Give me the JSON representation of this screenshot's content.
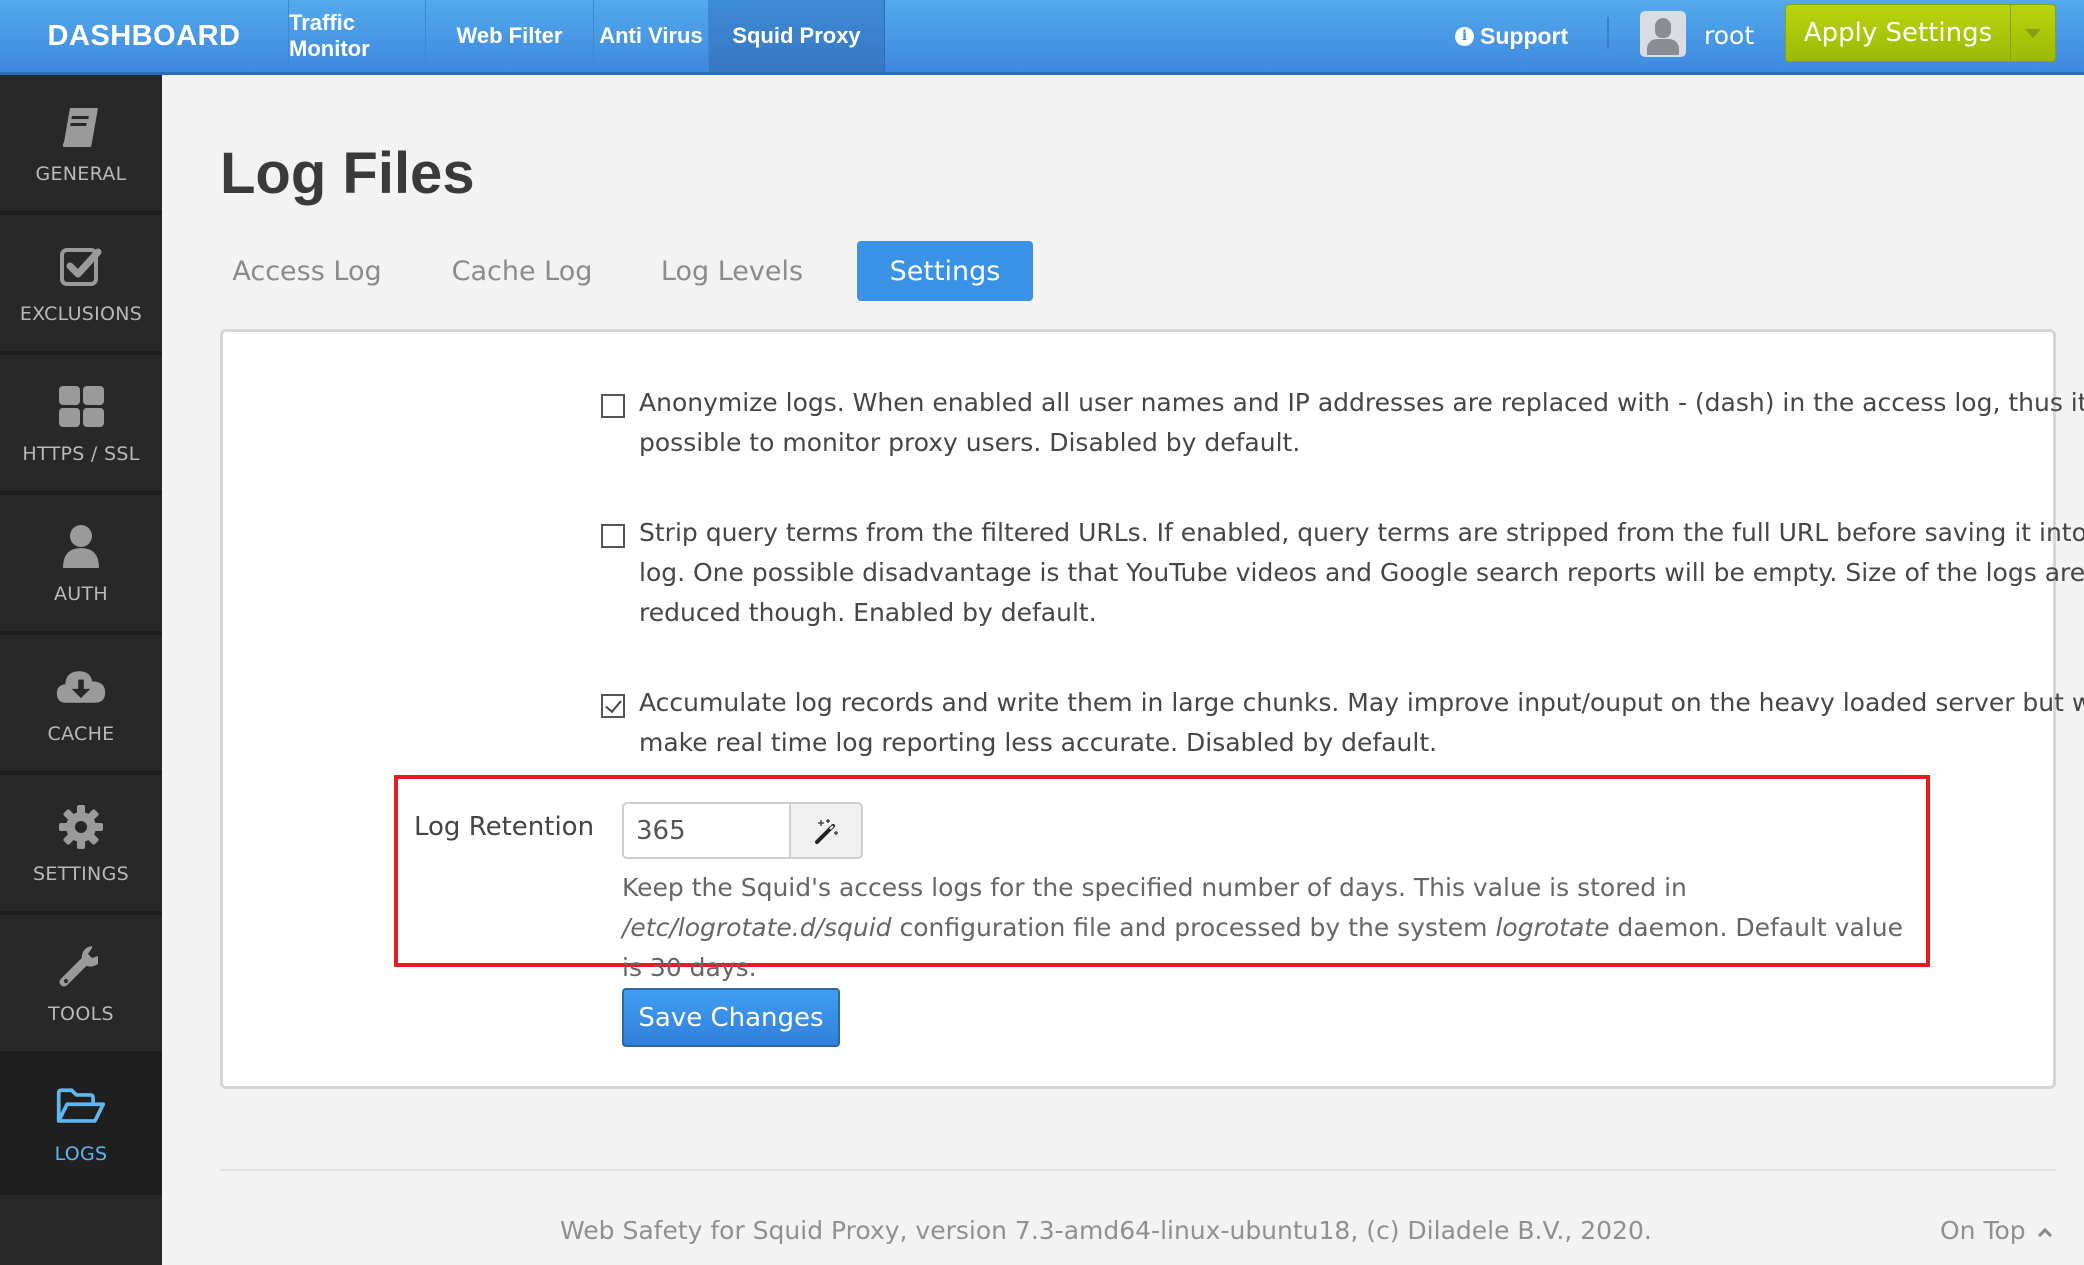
{
  "topnav": {
    "brand": "DASHBOARD",
    "items": [
      {
        "label": "Traffic Monitor",
        "active": false
      },
      {
        "label": "Web Filter",
        "active": false
      },
      {
        "label": "Anti Virus",
        "active": false
      },
      {
        "label": "Squid Proxy",
        "active": true
      }
    ],
    "support_label": "Support",
    "support_icon": "info-circle-icon",
    "user_icon": "user-avatar-icon",
    "username": "root",
    "apply_label": "Apply Settings",
    "apply_dropdown_icon": "caret-down-icon"
  },
  "sidebar": {
    "items": [
      {
        "label": "GENERAL",
        "icon": "book-icon",
        "active": false
      },
      {
        "label": "EXCLUSIONS",
        "icon": "check-square-icon",
        "active": false
      },
      {
        "label": "HTTPS / SSL",
        "icon": "grid-icon",
        "active": false
      },
      {
        "label": "AUTH",
        "icon": "user-icon",
        "active": false
      },
      {
        "label": "CACHE",
        "icon": "cloud-download-icon",
        "active": false
      },
      {
        "label": "SETTINGS",
        "icon": "gear-icon",
        "active": false
      },
      {
        "label": "TOOLS",
        "icon": "wrench-icon",
        "active": false
      },
      {
        "label": "LOGS",
        "icon": "folder-open-icon",
        "active": true
      }
    ]
  },
  "page": {
    "title": "Log Files",
    "tabs": [
      {
        "label": "Access Log",
        "active": false
      },
      {
        "label": "Cache Log",
        "active": false
      },
      {
        "label": "Log Levels",
        "active": false
      },
      {
        "label": "Settings",
        "active": true
      }
    ]
  },
  "settings": {
    "options": [
      {
        "checked": false,
        "text": "Anonymize logs. When enabled all user names and IP addresses are replaced with - (dash) in the access log, thus it is not possible to monitor proxy users. Disabled by default."
      },
      {
        "checked": false,
        "text": "Strip query terms from the filtered URLs. If enabled, query terms are stripped from the full URL before saving it into the access log. One possible disadvantage is that YouTube videos and Google search reports will be empty. Size of the logs are greatly reduced though. Enabled by default."
      },
      {
        "checked": true,
        "text": "Accumulate log records and write them in large chunks. May improve input/ouput on the heavy loaded server but will probably make real time log reporting less accurate. Disabled by default."
      }
    ],
    "retention": {
      "label": "Log Retention",
      "value": "365",
      "addon_icon": "magic-wand-icon",
      "help_part1": "Keep the Squid's access logs for the specified number of days. This value is stored in ",
      "help_path": "/etc/logrotate.d/squid",
      "help_part2": " configuration file and processed by the system ",
      "help_daemon": "logrotate",
      "help_part3": " daemon. Default value is 30 days."
    },
    "save_label": "Save Changes",
    "highlight_color": "#e51c23"
  },
  "footer": {
    "text": "Web Safety for Squid Proxy, version 7.3-amd64-linux-ubuntu18, (c) Diladele B.V., 2020.",
    "on_top_label": "On Top"
  },
  "colors": {
    "nav_blue": "#4a97e6",
    "apply_green": "#acc60a",
    "active_tab": "#3a92e6",
    "sidebar_active": "#5fb7ef",
    "sidebar_bg": "#282828"
  }
}
